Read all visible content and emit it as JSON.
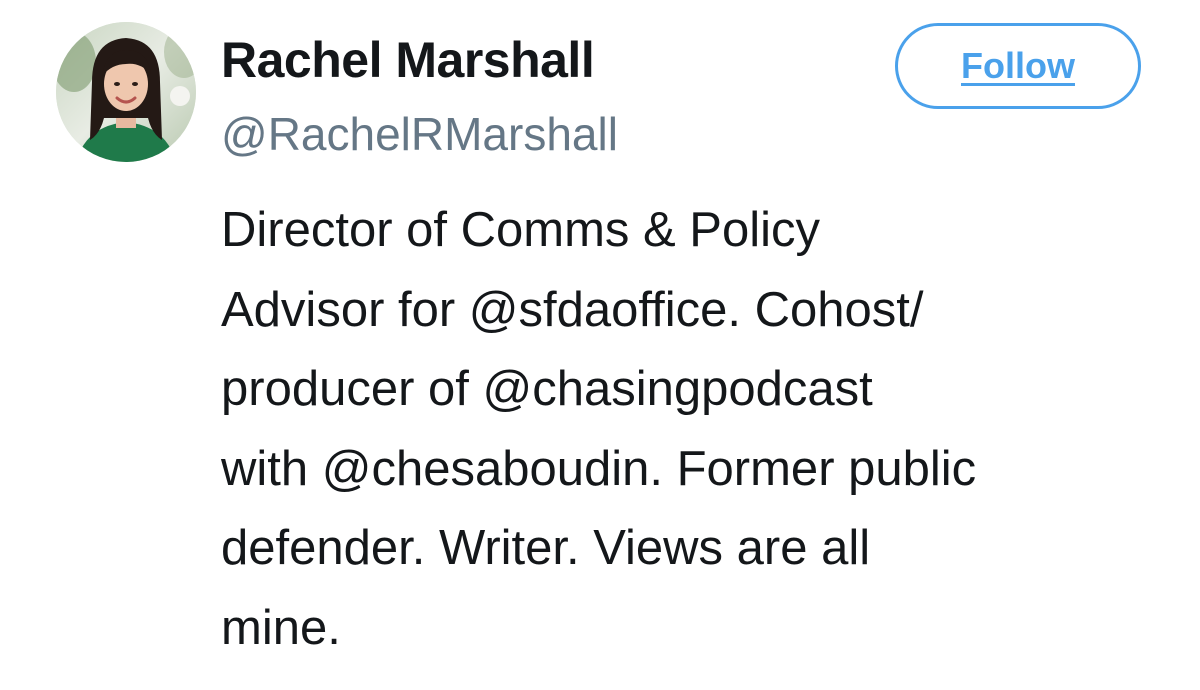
{
  "profile": {
    "name": "Rachel Marshall",
    "handle": "@RachelRMarshall",
    "avatar_icon": "profile-photo",
    "bio_lines": [
      "Director of Comms & Policy",
      "Advisor for @sfdaoffice. Cohost/",
      "producer of @chasingpodcast",
      "with @chesaboudin. Former public",
      "defender. Writer. Views are all",
      "mine."
    ]
  },
  "actions": {
    "follow_label": "Follow"
  },
  "colors": {
    "accent": "#4aa1eb",
    "name_text": "#14171a",
    "handle_text": "#657786"
  }
}
